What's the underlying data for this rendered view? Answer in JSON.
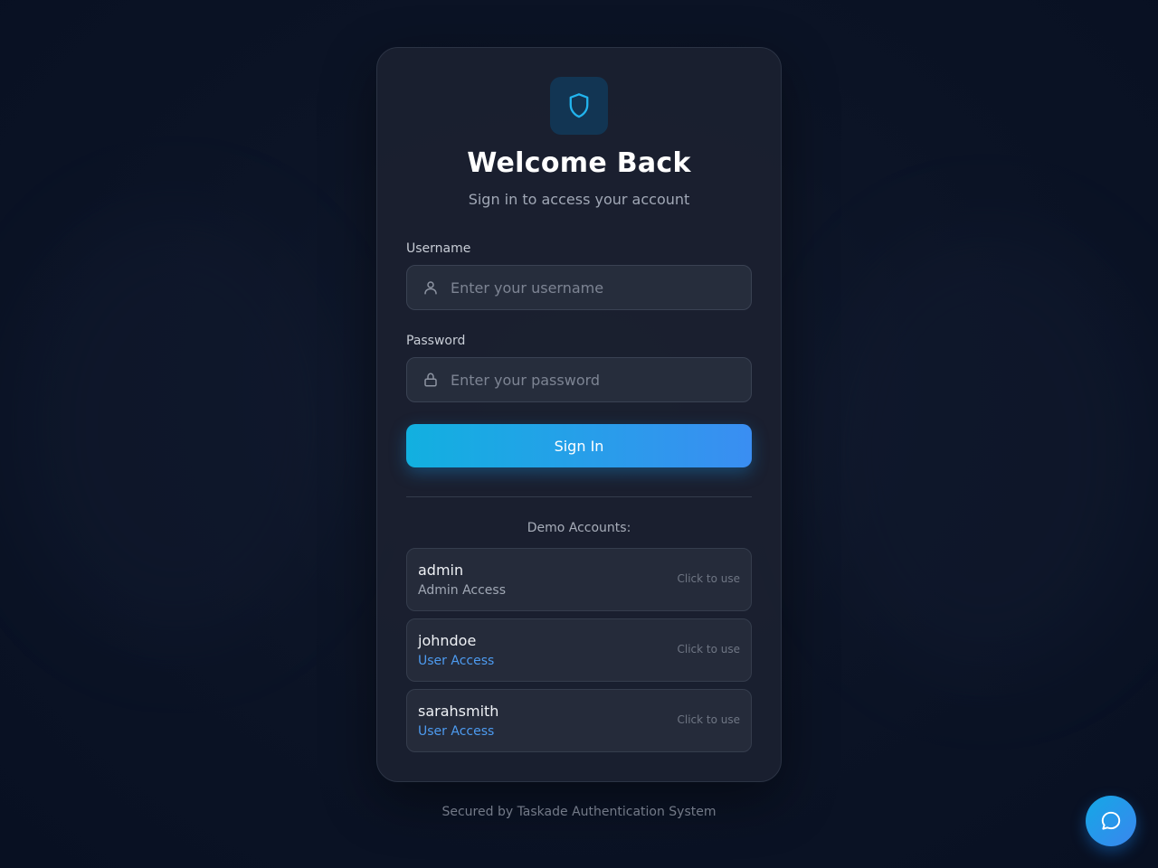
{
  "header": {
    "title": "Welcome Back",
    "subtitle": "Sign in to access your account",
    "logo_icon": "shield-icon"
  },
  "form": {
    "username": {
      "label": "Username",
      "placeholder": "Enter your username",
      "value": "",
      "icon": "user-icon"
    },
    "password": {
      "label": "Password",
      "placeholder": "Enter your password",
      "value": "",
      "icon": "lock-icon"
    },
    "submit_label": "Sign In"
  },
  "demo": {
    "title": "Demo Accounts:",
    "hint": "Click to use",
    "accounts": [
      {
        "username": "admin",
        "role": "Admin Access",
        "role_type": "admin"
      },
      {
        "username": "johndoe",
        "role": "User Access",
        "role_type": "user"
      },
      {
        "username": "sarahsmith",
        "role": "User Access",
        "role_type": "user"
      }
    ]
  },
  "footer": {
    "text": "Secured by Taskade Authentication System"
  },
  "chat": {
    "icon": "chat-bubble-icon"
  },
  "colors": {
    "accent_start": "#12b0e0",
    "accent_end": "#3a8ef2",
    "user_role": "#4d9bf0",
    "card_bg": "#1b2130",
    "page_bg": "#0c1426"
  }
}
